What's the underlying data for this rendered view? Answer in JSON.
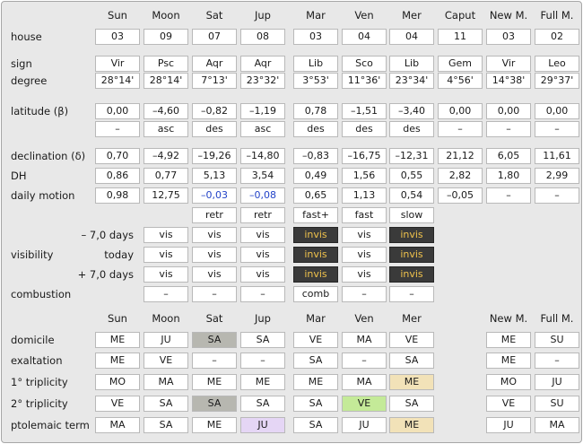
{
  "columns": [
    "Sun",
    "Moon",
    "Sat",
    "Jup",
    "Mar",
    "Ven",
    "Mer",
    "Caput",
    "New M.",
    "Full M."
  ],
  "labels": {
    "house": "house",
    "sign": "sign",
    "degree": "degree",
    "latitude": "latitude (β)",
    "declination": "declination (δ)",
    "dh": "DH",
    "daily_motion": "daily motion",
    "visibility": "visibility",
    "vis_minus": "– 7,0 days",
    "vis_today": "today",
    "vis_plus": "+ 7,0 days",
    "combustion": "combustion",
    "domicile": "domicile",
    "exaltation": "exaltation",
    "triplicity1": "1° triplicity",
    "triplicity2": "2° triplicity",
    "ptolemaic": "ptolemaic term"
  },
  "rows": {
    "house": [
      "03",
      "09",
      "07",
      "08",
      "03",
      "04",
      "04",
      "11",
      "03",
      "02"
    ],
    "sign": [
      "Vir",
      "Psc",
      "Aqr",
      "Aqr",
      "Lib",
      "Sco",
      "Lib",
      "Gem",
      "Vir",
      "Leo"
    ],
    "degree": [
      "28°14'",
      "28°14'",
      "7°13'",
      "23°32'",
      "3°53'",
      "11°36'",
      "23°34'",
      "4°56'",
      "14°38'",
      "29°37'"
    ],
    "latitude": [
      "0,00",
      "–4,60",
      "–0,82",
      "–1,19",
      "0,78",
      "–1,51",
      "–3,40",
      "0,00",
      "0,00",
      "0,00"
    ],
    "latitude_dir": [
      "–",
      "asc",
      "des",
      "asc",
      "des",
      "des",
      "des",
      "–",
      "–",
      "–"
    ],
    "declination": [
      "0,70",
      "–4,92",
      "–19,26",
      "–14,80",
      "–0,83",
      "–16,75",
      "–12,31",
      "21,12",
      "6,05",
      "11,61"
    ],
    "dh": [
      "0,86",
      "0,77",
      "5,13",
      "3,54",
      "0,49",
      "1,56",
      "0,55",
      "2,82",
      "1,80",
      "2,99"
    ],
    "daily_motion": [
      "0,98",
      "12,75",
      "–0,03",
      "–0,08",
      "0,65",
      "1,13",
      "0,54",
      "–0,05",
      "–",
      "–"
    ],
    "motion_state": [
      "retr",
      "retr",
      "fast+",
      "fast",
      "slow"
    ],
    "vis_minus": [
      "vis",
      "vis",
      "vis",
      "invis",
      "vis",
      "invis"
    ],
    "vis_today": [
      "vis",
      "vis",
      "vis",
      "invis",
      "vis",
      "invis"
    ],
    "vis_plus": [
      "vis",
      "vis",
      "vis",
      "invis",
      "vis",
      "invis"
    ],
    "combustion": [
      "–",
      "–",
      "–",
      "comb",
      "–",
      "–"
    ]
  },
  "dignity_columns": [
    "Sun",
    "Moon",
    "Sat",
    "Jup",
    "Mar",
    "Ven",
    "Mer",
    "New M.",
    "Full M."
  ],
  "dignities": {
    "domicile": [
      "ME",
      "JU",
      "SA",
      "SA",
      "VE",
      "MA",
      "VE",
      "ME",
      "SU"
    ],
    "exaltation": [
      "ME",
      "VE",
      "–",
      "–",
      "SA",
      "–",
      "SA",
      "ME",
      "–"
    ],
    "triplicity1": [
      "MO",
      "MA",
      "ME",
      "ME",
      "ME",
      "MA",
      "ME",
      "MO",
      "JU"
    ],
    "triplicity2": [
      "VE",
      "SA",
      "SA",
      "SA",
      "SA",
      "VE",
      "SA",
      "VE",
      "SU"
    ],
    "ptolemaic": [
      "MA",
      "SA",
      "ME",
      "JU",
      "SA",
      "JU",
      "ME",
      "JU",
      "MA"
    ]
  },
  "colors": {
    "invis_bg": "#3a3a3a",
    "invis_text": "#f0c24c",
    "retro_text": "#2343c8",
    "hl_gray": "#b7b7b0",
    "hl_green": "#c4ea98",
    "hl_tan": "#f2e2b8",
    "hl_lav": "#e5d6f5"
  }
}
